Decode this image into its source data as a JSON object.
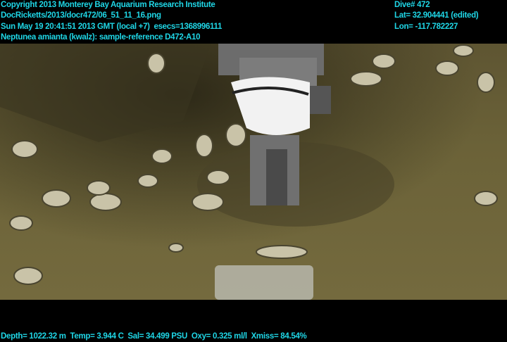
{
  "overlay_top_left": {
    "copyright": "Copyright 2013 Monterey Bay Aquarium Research Institute",
    "file": "DocRicketts/2013/docr472/06_51_11_16.png",
    "datetime": "Sun May 19 20:41:51 2013 GMT (local +7)  esecs=1368996111",
    "annotation": "Neptunea amianta (kwalz): sample-reference D472-A10"
  },
  "overlay_top_right": {
    "dive": "Dive# 472",
    "lat": "Lat= 32.904441 (edited)",
    "lon": "Lon= -117.782227"
  },
  "overlay_bottom": {
    "sensors": "Depth= 1022.32 m  Temp= 3.944 C  Sal= 34.499 PSU  Oxy= 0.325 ml/l  Xmiss= 84.54%"
  },
  "colors": {
    "overlay_text": "#1fd6e6",
    "sediment": "#6b6238"
  }
}
